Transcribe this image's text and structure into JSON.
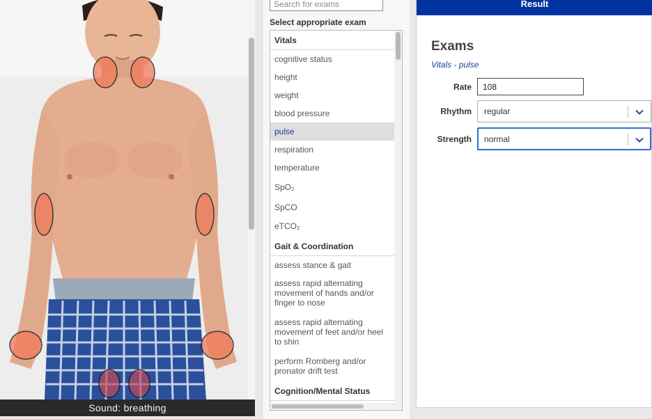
{
  "viewer": {
    "sound_label": "Sound: breathing"
  },
  "exam_list": {
    "search_placeholder": "Search for exams",
    "select_label": "Select appropriate exam",
    "groups": [
      {
        "title": "Vitals",
        "items": [
          "cognitive status",
          "height",
          "weight",
          "blood pressure",
          "pulse",
          "respiration",
          "temperature",
          "SpO₂",
          "SpCO",
          "eTCO₂"
        ]
      },
      {
        "title": "Gait & Coordination",
        "items": [
          "assess stance & gait",
          "assess rapid alternating movement of hands and/or finger to nose",
          "assess rapid alternating movement of feet and/or heel to shin",
          "perform Romberg and/or pronator drift test"
        ]
      },
      {
        "title": "Cognition/Mental Status",
        "items": []
      }
    ],
    "selected_item": "pulse"
  },
  "result": {
    "header": "Result",
    "title": "Exams",
    "subtitle": "Vitals - pulse",
    "rate_label": "Rate",
    "rate_value": "108",
    "rhythm_label": "Rhythm",
    "rhythm_value": "regular",
    "strength_label": "Strength",
    "strength_value": "normal"
  },
  "colors": {
    "accent": "#0033a0",
    "selected_text": "#1c3f94",
    "pulse_marker": "#f07a5a",
    "focus_border": "#2d6fd1"
  },
  "icons": {
    "dropdown": "chevron-down-icon"
  }
}
